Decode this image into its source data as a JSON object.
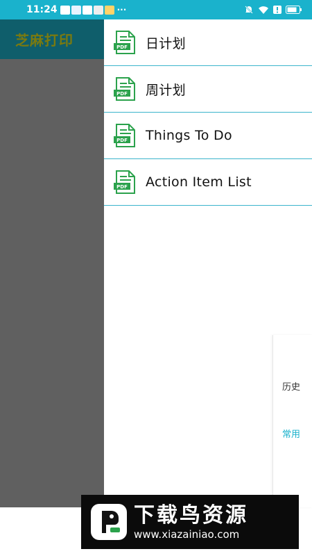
{
  "status_bar": {
    "time": "11:24",
    "notification_icons": [
      "app-icon",
      "cloud-icon",
      "app-icon",
      "chat-icon",
      "mail-icon"
    ],
    "more": "···",
    "right_icons": [
      "mute-icon",
      "wifi-icon",
      "alert-icon",
      "battery-icon"
    ]
  },
  "app_bar": {
    "title": "芝麻打印"
  },
  "drawer": {
    "items": [
      {
        "label": "日计划",
        "icon": "pdf-file-icon"
      },
      {
        "label": "周计划",
        "icon": "pdf-file-icon"
      },
      {
        "label": "Things To Do",
        "icon": "pdf-file-icon"
      },
      {
        "label": "Action Item List",
        "icon": "pdf-file-icon"
      }
    ]
  },
  "side_tabs": {
    "history": "历史",
    "common": "常用"
  },
  "watermark": {
    "title": "下载鸟资源",
    "url": "www.xiazainiao.com"
  },
  "colors": {
    "status_bar": "#1ab2cc",
    "app_bar": "#0f5e6b",
    "accent": "#1ab2cc",
    "pdf_green": "#2ba24c"
  }
}
